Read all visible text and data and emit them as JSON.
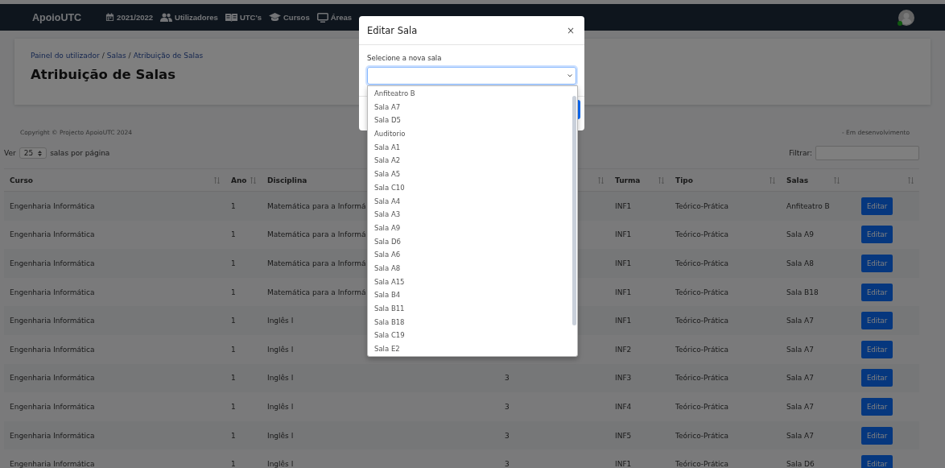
{
  "navbar": {
    "brand": "ApoioUTC",
    "user_online": true,
    "items": [
      {
        "label": "2021/2022"
      },
      {
        "label": "Utilizadores"
      },
      {
        "label": "UTC's"
      },
      {
        "label": "Cursos"
      },
      {
        "label": "Áreas"
      }
    ]
  },
  "header": {
    "breadcrumb": [
      "Painel do utilizador",
      "Salas",
      "Atribuição de Salas"
    ],
    "separator": "/",
    "title": "Atribuição de Salas"
  },
  "footer": {
    "copyright": "Copyright © Projecto ApoioUTC 2024",
    "status": "- Em desenvolvimento"
  },
  "table_controls": {
    "show_label": "Ver",
    "page_size": "25",
    "per_page_label": "salas por página",
    "filter_label": "Filtrar:"
  },
  "table": {
    "columns": [
      {
        "label": "Curso",
        "sortable": true
      },
      {
        "label": "Ano",
        "sortable": true
      },
      {
        "label": "Disciplina"
      },
      {
        "sortable": true
      },
      {
        "label": "Turma",
        "sortable": true
      },
      {
        "label": "Tipo",
        "sortable": true
      },
      {
        "label": "Salas",
        "sortable": true
      },
      {
        "sortable": true
      }
    ],
    "rows": [
      {
        "curso": "Engenharia Informática",
        "ano": "1",
        "disciplina": "Matemática para a Informá",
        "turma": "INF1",
        "tipo": "Teórico-Prática",
        "sala": "Anfiteatro B",
        "action": "Editar"
      },
      {
        "curso": "Engenharia Informática",
        "ano": "1",
        "disciplina": "Matemática para a Informá",
        "turma": "INF1",
        "tipo": "Teórico-Prática",
        "sala": "Sala A9",
        "action": "Editar"
      },
      {
        "curso": "Engenharia Informática",
        "ano": "1",
        "disciplina": "Matemática para a Informá",
        "turma": "INF1",
        "tipo": "Teórico-Prática",
        "sala": "Sala A8",
        "action": "Editar"
      },
      {
        "curso": "Engenharia Informática",
        "ano": "1",
        "disciplina": "Matemática para a Informá",
        "turma": "INF1",
        "tipo": "Teórico-Prática",
        "sala": "Sala B18",
        "action": "Editar"
      },
      {
        "curso": "Engenharia Informática",
        "ano": "1",
        "disciplina": "Inglês I",
        "turma": "INF1",
        "tipo": "Teórico-Prática",
        "sala": "Sala A7",
        "action": "Editar"
      },
      {
        "curso": "Engenharia Informática",
        "ano": "1",
        "disciplina": "Inglês I",
        "turma": "INF2",
        "tipo": "Teórico-Prática",
        "sala": "Sala A7",
        "action": "Editar"
      },
      {
        "curso": "Engenharia Informática",
        "ano": "1",
        "disciplina": "Inglês I",
        "column_4": "3",
        "turma": "INF3",
        "tipo": "Teórico-Prática",
        "sala": "Sala A7",
        "action": "Editar"
      },
      {
        "curso": "Engenharia Informática",
        "ano": "1",
        "disciplina": "Inglês I",
        "column_4": "3",
        "turma": "INF4",
        "tipo": "Teórico-Prática",
        "sala": "Sala A7",
        "action": "Editar"
      },
      {
        "curso": "Engenharia Informática",
        "ano": "1",
        "disciplina": "Inglês I",
        "column_4": "3",
        "turma": "INF5",
        "tipo": "Teórico-Prática",
        "sala": "Sala A7",
        "action": "Editar"
      },
      {
        "curso": "Engenharia Informática",
        "ano": "1",
        "disciplina": "Inglês I",
        "column_4": "3",
        "turma": "INF1",
        "tipo": "Teórico-Prática",
        "sala": "Sala D6",
        "action": "Editar"
      }
    ]
  },
  "modal": {
    "title": "Editar Sala",
    "close": "×",
    "label": "Selecione a nova sala",
    "options": [
      "Anfiteatro B",
      "Sala A7",
      "Sala D5",
      "Auditorio",
      "Sala A1",
      "Sala A2",
      "Sala A5",
      "Sala C10",
      "Sala A4",
      "Sala A3",
      "Sala A9",
      "Sala D6",
      "Sala A6",
      "Sala A8",
      "Sala A15",
      "Sala B4",
      "Sala B11",
      "Sala B18",
      "Sala C19",
      "Sala E2"
    ]
  }
}
